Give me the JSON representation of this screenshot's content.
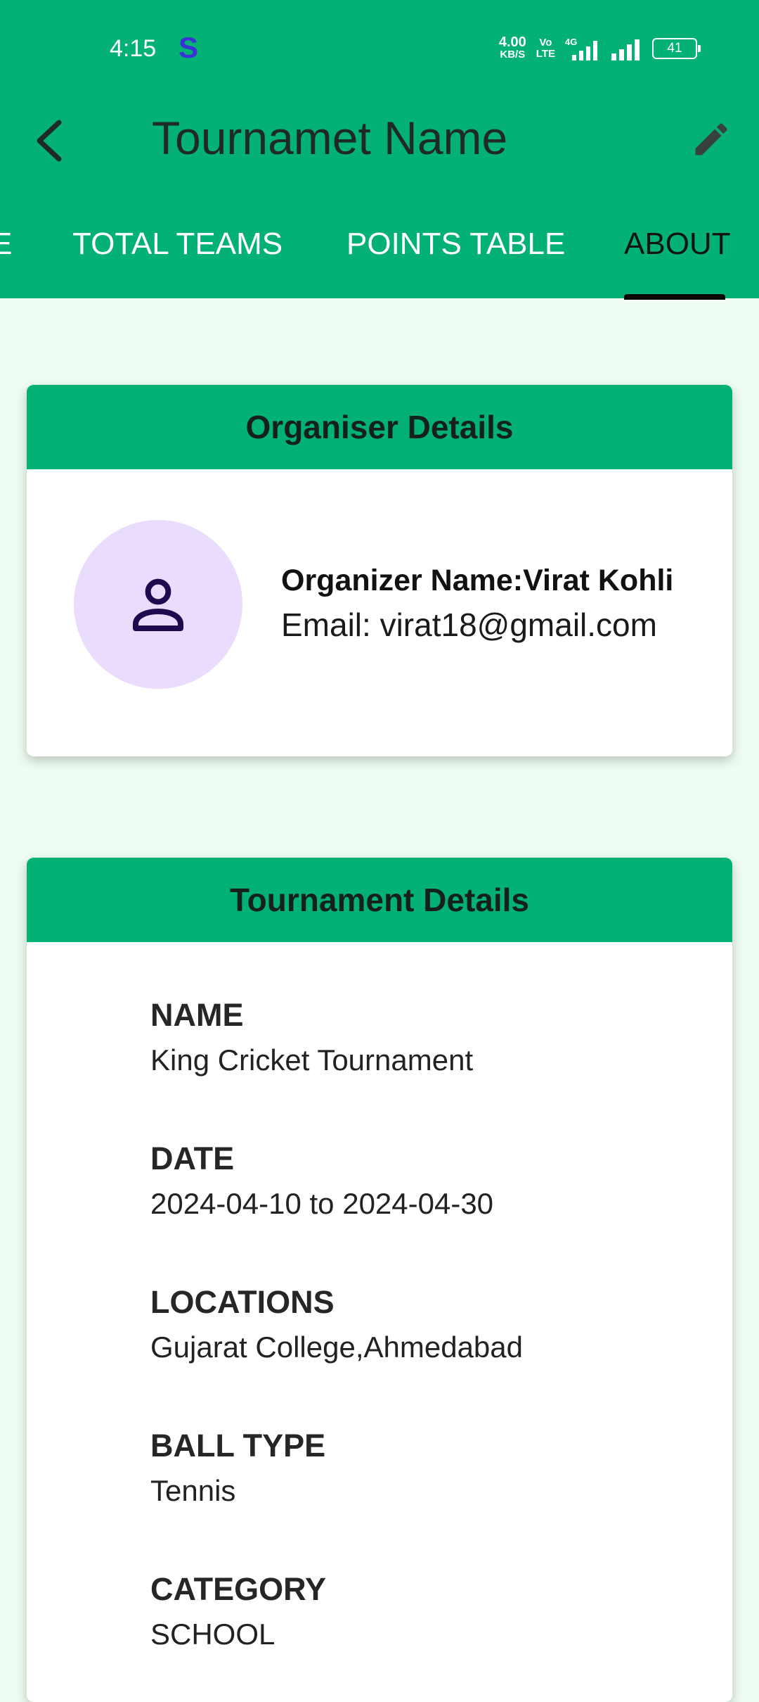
{
  "status_bar": {
    "time": "4:15",
    "app_indicator": "S",
    "net_speed_value": "4.00",
    "net_speed_unit": "KB/S",
    "volte_top": "Vo",
    "volte_bottom": "LTE",
    "network": "4G",
    "battery": "41"
  },
  "toolbar": {
    "title": "Tournamet Name",
    "back_icon": "chevron-left-icon",
    "edit_icon": "pencil-icon"
  },
  "tabs": [
    {
      "label": "E",
      "active": false
    },
    {
      "label": "TOTAL TEAMS",
      "active": false
    },
    {
      "label": "POINTS TABLE",
      "active": false
    },
    {
      "label": "ABOUT",
      "active": true
    }
  ],
  "organiser": {
    "header": "Organiser Details",
    "name_line": "Organizer Name:Virat Kohli",
    "email_line": "Email: virat18@gmail.com",
    "avatar_icon": "person-icon"
  },
  "tournament": {
    "header": "Tournament Details",
    "fields": [
      {
        "label": "NAME",
        "value": "King Cricket Tournament"
      },
      {
        "label": "DATE",
        "value": "2024-04-10 to 2024-04-30"
      },
      {
        "label": "LOCATIONS",
        "value": "Gujarat College,Ahmedabad"
      },
      {
        "label": "BALL TYPE",
        "value": "Tennis"
      },
      {
        "label": "CATEGORY",
        "value": "SCHOOL"
      }
    ]
  },
  "colors": {
    "primary": "#03b175",
    "background": "#eefcf1",
    "avatar_bg": "#e9dcfc",
    "avatar_icon": "#1f0a4f"
  }
}
